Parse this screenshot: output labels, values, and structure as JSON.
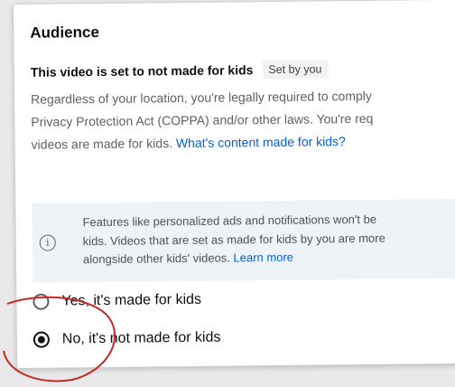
{
  "audience": {
    "heading": "Audience",
    "status": "This video is set to not made for kids",
    "badge": "Set by you",
    "description": {
      "line1": "Regardless of your location, you're legally required to comply",
      "line2": "Privacy Protection Act (COPPA) and/or other laws. You're req",
      "line3": "videos are made for kids. ",
      "link": "What's content made for kids?"
    },
    "info": {
      "icon": "info-icon",
      "line1": "Features like personalized ads and notifications won't be",
      "line2": "kids. Videos that are set as made for kids by you are more",
      "line3": "alongside other kids' videos. ",
      "link": "Learn more"
    },
    "options": [
      {
        "label": "Yes, it's made for kids",
        "selected": false
      },
      {
        "label": "No, it's not made for kids",
        "selected": true
      }
    ]
  },
  "colors": {
    "link": "#065fd4",
    "info_background": "#eef3f8",
    "annotation_circle": "#c62828"
  }
}
